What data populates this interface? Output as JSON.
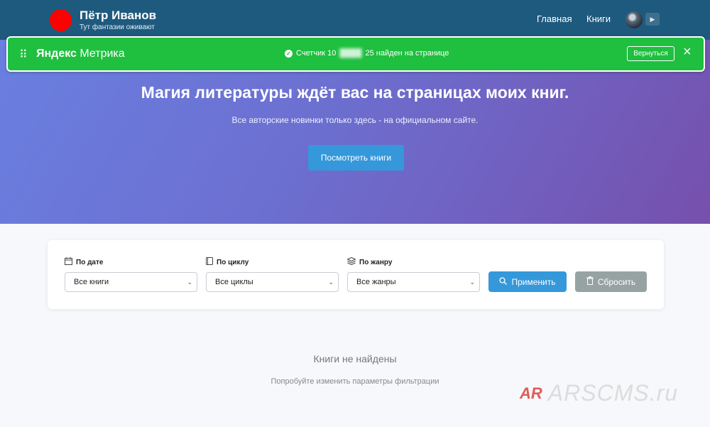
{
  "header": {
    "brand_name": "Пётр Иванов",
    "brand_tagline": "Тут фантазии оживают",
    "nav": {
      "home": "Главная",
      "books": "Книги"
    },
    "menu_icon": "play-triangle"
  },
  "hero": {
    "title": "Магия литературы ждёт вас на страницах моих книг.",
    "subtitle": "Все авторские новинки только здесь - на официальном сайте.",
    "button_label": "Посмотреть книги"
  },
  "metrika": {
    "logo_bold": "Яндекс",
    "logo_light": " Метрика",
    "status_prefix": "Счетчик 10",
    "status_counter_hidden": "████",
    "status_suffix": "25 найден на странице",
    "return_label": "Вернуться",
    "close_icon": "×",
    "bar_color": "#1fbf3f"
  },
  "filters": {
    "date": {
      "label": "По дате",
      "selected": "Все книги",
      "icon": "calendar-icon"
    },
    "cycle": {
      "label": "По циклу",
      "selected": "Все циклы",
      "icon": "book-icon"
    },
    "genre": {
      "label": "По жанру",
      "selected": "Все жанры",
      "icon": "layers-icon"
    },
    "apply_label": "Применить",
    "reset_label": "Сбросить"
  },
  "empty_state": {
    "title": "Книги не найдены",
    "subtitle": "Попробуйте изменить параметры фильтрации"
  },
  "watermark": {
    "mark": "AR",
    "text": "ARSCMS.ru"
  },
  "colors": {
    "header_bg": "#1e5a7e",
    "accent": "#3498db",
    "metrika_green": "#1fbf3f",
    "reset_gray": "#97a3a3"
  }
}
